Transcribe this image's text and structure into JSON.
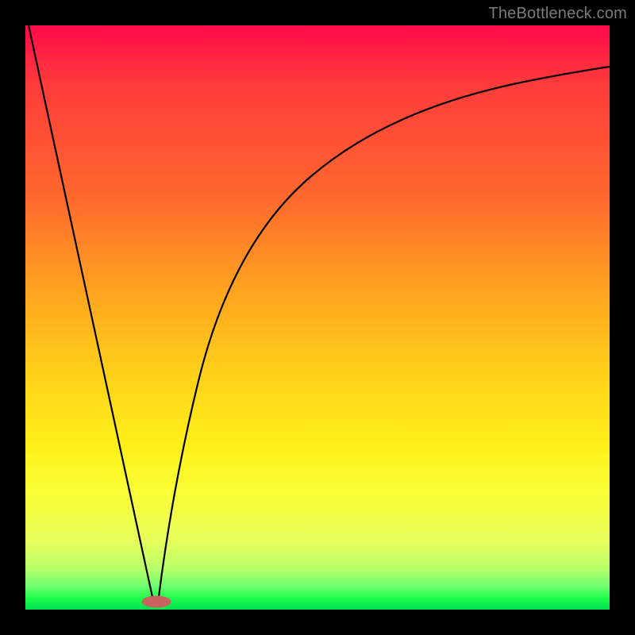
{
  "attribution": "TheBottleneck.com",
  "chart_data": {
    "type": "line",
    "title": "",
    "xlabel": "",
    "ylabel": "",
    "xlim": [
      0,
      100
    ],
    "ylim": [
      0,
      100
    ],
    "grid": false,
    "legend": false,
    "series": [
      {
        "name": "left-branch",
        "x": [
          0,
          4,
          8,
          12,
          16,
          20,
          22
        ],
        "values": [
          100,
          82,
          64,
          46,
          28,
          10,
          2
        ]
      },
      {
        "name": "right-branch",
        "x": [
          22,
          24,
          26,
          28,
          32,
          36,
          40,
          45,
          50,
          55,
          60,
          70,
          80,
          90,
          100
        ],
        "values": [
          2,
          10,
          22,
          32,
          46,
          56,
          63,
          70,
          75,
          79,
          82,
          86,
          89,
          91,
          93
        ]
      }
    ],
    "annotations": [
      {
        "name": "minimum-marker",
        "x": 22,
        "y": 2
      }
    ],
    "background_gradient_stops": [
      {
        "pos": 0.0,
        "color": "#ff0a4a"
      },
      {
        "pos": 0.5,
        "color": "#ffb71f"
      },
      {
        "pos": 0.8,
        "color": "#f5ff30"
      },
      {
        "pos": 1.0,
        "color": "#00e050"
      }
    ]
  }
}
